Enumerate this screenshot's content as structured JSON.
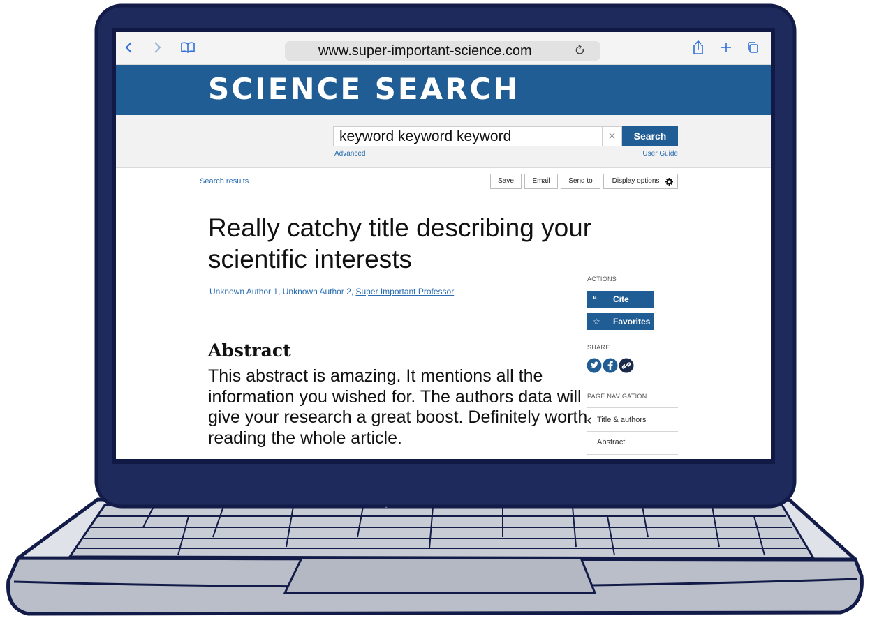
{
  "browser": {
    "url": "www.super-important-science.com",
    "icons": [
      "back-icon",
      "forward-icon",
      "bookmarks-icon",
      "reload-icon",
      "share-icon",
      "new-tab-icon",
      "tabs-icon"
    ]
  },
  "site": {
    "title": "SCIENCE SEARCH",
    "brand_color": "#215d95"
  },
  "search": {
    "query": "keyword keyword keyword",
    "clear_symbol": "×",
    "button_label": "Search",
    "advanced_label": "Advanced",
    "user_guide_label": "User Guide"
  },
  "results_bar": {
    "results_link": "Search results",
    "buttons": [
      "Save",
      "Email",
      "Send to",
      "Display options"
    ]
  },
  "article": {
    "title": "Really catchy title describing your scientific interests",
    "authors": [
      "Unknown Author 1",
      "Unknown Author 2",
      "Super Important Professor"
    ],
    "author_separator": ", ",
    "abstract_heading": "Abstract",
    "abstract_text": "This abstract is amazing. It mentions all the information you wished for. The authors data will give your research a great boost. Definitely worth reading the whole article."
  },
  "sidebar": {
    "actions_label": "ACTIONS",
    "cite_label": "Cite",
    "cite_icon": "“",
    "favorites_label": "Favorites",
    "favorites_icon": "☆",
    "share_label": "SHARE",
    "share_icons": [
      "twitter-icon",
      "facebook-icon",
      "link-icon"
    ],
    "page_nav_label": "PAGE NAVIGATION",
    "nav_items": [
      "Title & authors",
      "Abstract"
    ]
  }
}
